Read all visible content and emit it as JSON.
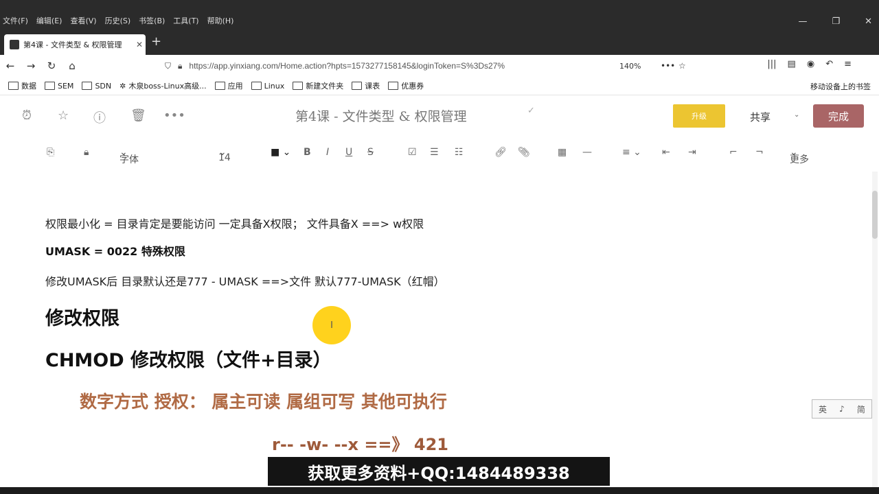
{
  "browser": {
    "menus": [
      "文件(F)",
      "编辑(E)",
      "查看(V)",
      "历史(S)",
      "书签(B)",
      "工具(T)",
      "帮助(H)"
    ],
    "tab_title": "第4课 - 文件类型 & 权限管理",
    "url": "https://app.yinxiang.com/Home.action?hpts=1573277158145&loginToken=S%3Ds27%",
    "zoom": "140%",
    "bookmarks": [
      "数据",
      "SEM",
      "SDN",
      "木泉boss-Linux高级...",
      "应用",
      "Linux",
      "新建文件夹",
      "课表",
      "优惠券"
    ],
    "mobile_bookmarks": "移动设备上的书签"
  },
  "editor": {
    "title": "第4课 - 文件类型 & 权限管理",
    "yellow_button": "升级",
    "share": "共享",
    "done": "完成"
  },
  "toolbar": {
    "font": "字体",
    "size": "14",
    "more": "更多"
  },
  "content": {
    "line1": "权限最小化 = 目录肯定是要能访问 一定具备X权限；  文件具备X ==> w权限",
    "line2": "UMASK = 0022  特殊权限",
    "line3": "修改UMASK后  目录默认还是777 - UMASK  ==>文件 默认777-UMASK（红帽）",
    "heading_modify": "修改权限",
    "heading_chmod": "CHMOD    修改权限（文件+目录）",
    "numeric_line": "数字方式  授权：   属主可读   属组可写   其他可执行",
    "perm_line": "r--              -w-                --x   ==》  421"
  },
  "cursor_glyph": "I",
  "side_widget": [
    "英",
    "♪",
    "简"
  ],
  "banner": "获取更多资料+QQ:1484489338",
  "colors": {
    "done_button": "#a96566",
    "yellow_button": "#ecc531",
    "accent_text": "#b06a44",
    "cursor_highlight": "#ffd21d"
  }
}
